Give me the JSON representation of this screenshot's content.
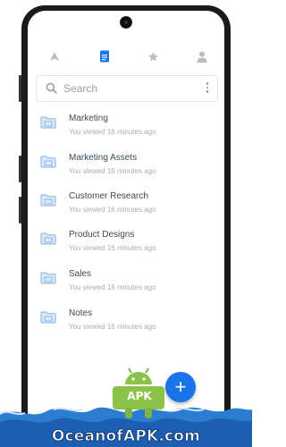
{
  "tabs": [
    {
      "icon": "home-icon",
      "active": false
    },
    {
      "icon": "files-icon",
      "active": true
    },
    {
      "icon": "star-icon",
      "active": false
    },
    {
      "icon": "account-icon",
      "active": false
    }
  ],
  "search": {
    "placeholder": "Search"
  },
  "files": [
    {
      "name": "Marketing",
      "meta": "You viewed 16 minutes ago"
    },
    {
      "name": "Marketing Assets",
      "meta": "You viewed 16 minutes ago"
    },
    {
      "name": "Customer Research",
      "meta": "You viewed 16 minutes ago"
    },
    {
      "name": "Product Designs",
      "meta": "You viewed 16 minutes ago"
    },
    {
      "name": "Sales",
      "meta": "You viewed 16 minutes ago"
    },
    {
      "name": "Notes",
      "meta": "You viewed 16 minutes ago"
    }
  ],
  "fab": {
    "label": "+"
  },
  "watermark": {
    "badge": "APK",
    "text": "OceanofAPK.com"
  },
  "colors": {
    "accent": "#1b73e8",
    "folder": "#7fb2e5",
    "tab_inactive": "#b9bec4"
  }
}
